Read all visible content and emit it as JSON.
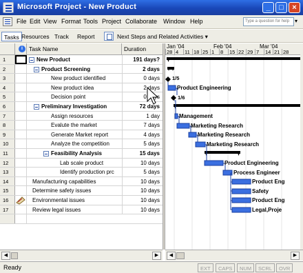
{
  "window": {
    "title": "Microsoft Project - New Product"
  },
  "menu": [
    "File",
    "Edit",
    "View",
    "Format",
    "Tools",
    "Project",
    "Collaborate",
    "Window",
    "Help"
  ],
  "help_placeholder": "Type a question for help",
  "guide": {
    "tabs": [
      "Tasks",
      "Resources",
      "Track",
      "Report"
    ],
    "next_steps": "Next Steps and Related Activities"
  },
  "table": {
    "headers": {
      "name": "Task Name",
      "duration": "Duration"
    },
    "rows": [
      {
        "id": "1",
        "name": "New Product",
        "duration": "191 days?",
        "summary": true
      },
      {
        "id": "2",
        "name": "Product Screening",
        "duration": "2 days",
        "summary": true
      },
      {
        "id": "3",
        "name": "New product identified",
        "duration": "0 days",
        "summary": false
      },
      {
        "id": "4",
        "name": "New product idea",
        "duration": "2 days",
        "summary": false
      },
      {
        "id": "5",
        "name": "Decision point",
        "duration": "0 days",
        "summary": false
      },
      {
        "id": "6",
        "name": "Preliminary Investigation",
        "duration": "72 days",
        "summary": true
      },
      {
        "id": "7",
        "name": "Assign resources",
        "duration": "1 day",
        "summary": false
      },
      {
        "id": "8",
        "name": "Evalute the market",
        "duration": "7 days",
        "summary": false
      },
      {
        "id": "9",
        "name": "Generate Market report",
        "duration": "4 days",
        "summary": false
      },
      {
        "id": "10",
        "name": "Analyze the competition",
        "duration": "5 days",
        "summary": false
      },
      {
        "id": "11",
        "name": "Feasibility Analysis",
        "duration": "15 days",
        "summary": true
      },
      {
        "id": "12",
        "name": "Lab scale product",
        "duration": "10 days",
        "summary": false
      },
      {
        "id": "13",
        "name": "Identify production prc",
        "duration": "5 days",
        "summary": false
      },
      {
        "id": "14",
        "name": "Manufacturing capabilities",
        "duration": "10 days",
        "summary": false
      },
      {
        "id": "15",
        "name": "Determine safety issues",
        "duration": "10 days",
        "summary": false
      },
      {
        "id": "16",
        "name": "Environmental issues",
        "duration": "10 days",
        "summary": false
      },
      {
        "id": "17",
        "name": "Review legal issues",
        "duration": "10 days",
        "summary": false
      }
    ]
  },
  "timescale": {
    "months": [
      "Jan '04",
      "Feb '04",
      "Mar '04"
    ],
    "days": [
      "28",
      "4",
      "11",
      "18",
      "25",
      "1",
      "8",
      "15",
      "22",
      "29",
      "7",
      "14",
      "21",
      "28"
    ]
  },
  "gantt_labels": {
    "r3": "1/5",
    "r4": "Product Engineering",
    "r5": "1/6",
    "r7": "Management",
    "r8": "Marketing Research",
    "r9": "Marketing Research",
    "r10": "Marketing Research",
    "r12": "Product Engineering",
    "r13": "Process Engineer",
    "r14": "Product Eng",
    "r15": "Safety",
    "r16": "Product Eng",
    "r17": "Legal,Proje"
  },
  "status": {
    "text": "Ready",
    "indicators": [
      "EXT",
      "CAPS",
      "NUM",
      "SCRL",
      "OVR"
    ]
  },
  "colors": {
    "title_bar": "#1947b8",
    "gantt_bar": "#3b6fe0",
    "summary_bar": "#000000",
    "chrome": "#eeede5"
  }
}
